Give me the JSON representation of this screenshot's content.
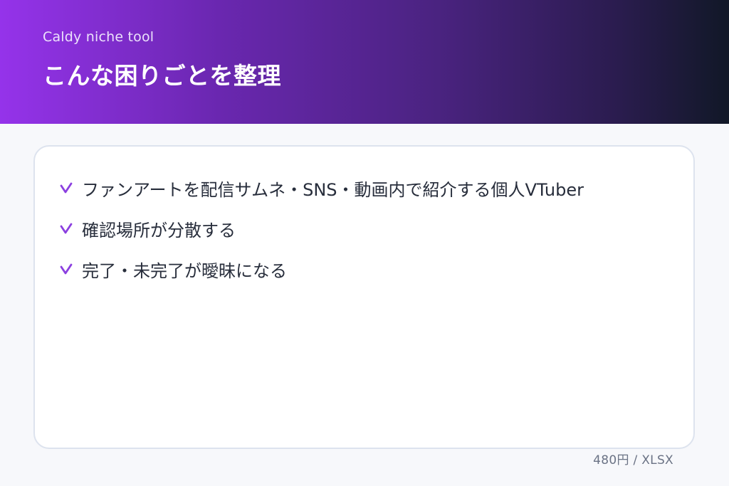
{
  "header": {
    "brand": "Caldy niche tool",
    "title": "こんな困りごとを整理"
  },
  "problems": {
    "items": [
      {
        "label": "ファンアートを配信サムネ・SNS・動画内で紹介する個人VTuber"
      },
      {
        "label": "確認場所が分散する"
      },
      {
        "label": "完了・未完了が曖昧になる"
      }
    ]
  },
  "footer": {
    "price_format": "480円 / XLSX"
  },
  "colors": {
    "accent": "#8b3fe0",
    "header_start": "#9533ea",
    "header_end": "#111827"
  },
  "icons": {
    "bullet": "check-icon"
  }
}
